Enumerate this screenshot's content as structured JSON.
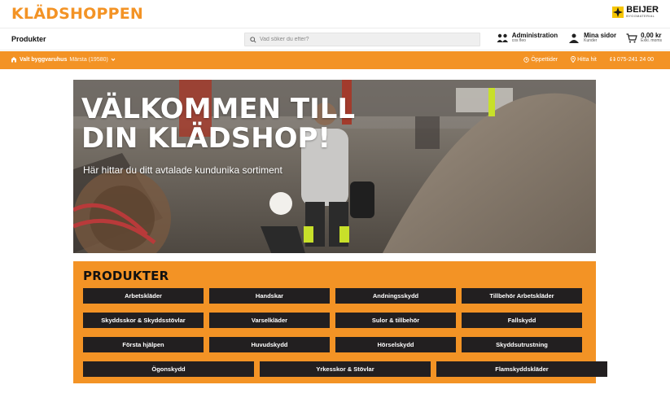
{
  "brand": {
    "name": "KLÄDSHOPPEN",
    "color": "#f39325"
  },
  "partner": {
    "name": "BEIJER",
    "sub": "BYGGMATERIAL"
  },
  "nav": {
    "products_label": "Produkter",
    "search_placeholder": "Vad söker du efter?",
    "admin": {
      "main": "Administration",
      "sub": "cos fleo"
    },
    "mypages": {
      "main": "Mina sidor",
      "sub": "Kunder"
    },
    "cart": {
      "main": "0,00 kr",
      "sub": "Exkl. moms"
    }
  },
  "orange_bar": {
    "store_bold": "Valt byggvaruhus",
    "store_name": "Märsta (19580)",
    "opening_hours": "Öppettider",
    "find_us": "Hitta hit",
    "phone": "075-241 24 00"
  },
  "hero": {
    "title_line1": "VÄLKOMMEN TILL",
    "title_line2": "DIN KLÄDSHOP!",
    "subtitle": "Här hittar du ditt avtalade kundunika sortiment"
  },
  "products": {
    "title": "PRODUKTER",
    "rows": [
      [
        "Arbetskläder",
        "Handskar",
        "Andningsskydd",
        "Tillbehör Arbetskläder"
      ],
      [
        "Skyddsskor & Skyddsstövlar",
        "Varselkläder",
        "Sulor & tillbehör",
        "Fallskydd"
      ],
      [
        "Första hjälpen",
        "Huvudskydd",
        "Hörselskydd",
        "Skyddsutrustning"
      ],
      [
        "Ögonskydd",
        "Yrkesskor & Stövlar",
        "Flamskyddskläder"
      ]
    ]
  },
  "colors": {
    "accent": "#f39325",
    "button": "#221f20"
  },
  "icons": [
    "search-icon",
    "admin-icon",
    "user-icon",
    "cart-icon",
    "store-icon",
    "clock-icon",
    "pin-icon",
    "phone-icon",
    "chevron-down-icon"
  ]
}
